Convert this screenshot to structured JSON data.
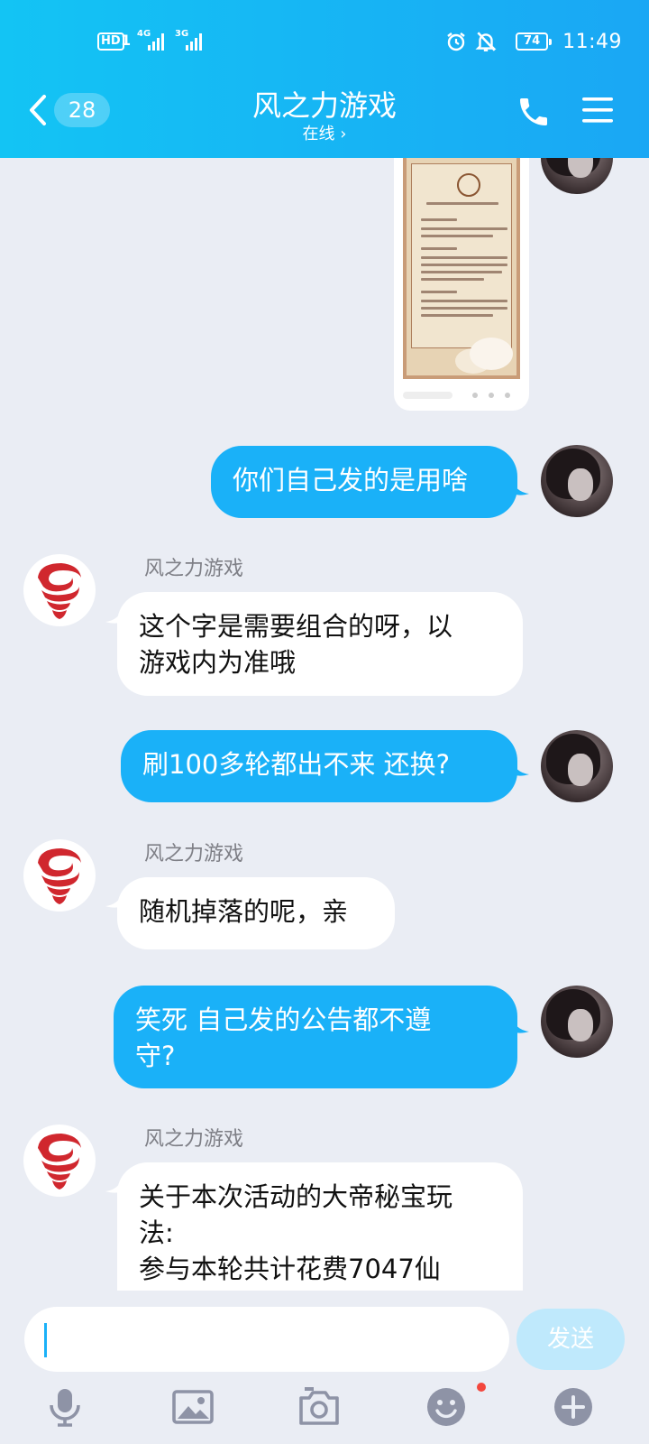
{
  "status_bar": {
    "hd": "HD",
    "sim1": "1",
    "net1": "4G",
    "net2": "3G",
    "battery": "74",
    "time": "11:49"
  },
  "header": {
    "back_count": "28",
    "title": "风之力游戏",
    "subtitle": "在线 ›"
  },
  "messages": [
    {
      "side": "me",
      "type": "image",
      "icon": "announcement-poster-image"
    },
    {
      "side": "me",
      "text": "你们自己发的是用啥"
    },
    {
      "side": "them",
      "sender": "风之力游戏",
      "lines": [
        "这个字是需要组合的呀，以",
        "游戏内为准哦"
      ]
    },
    {
      "side": "me",
      "text": "刷100多轮都出不来 还换?"
    },
    {
      "side": "them",
      "sender": "风之力游戏",
      "text": "随机掉落的呢，亲"
    },
    {
      "side": "me",
      "lines": [
        "笑死 自己发的公告都不遵",
        "守?"
      ]
    },
    {
      "side": "them",
      "sender": "风之力游戏",
      "lines": [
        "关于本次活动的大帝秘宝玩",
        "法:",
        "参与本轮共计花费7047仙"
      ]
    }
  ],
  "input": {
    "value": "",
    "send_label": "发送"
  },
  "toolbar": [
    "microphone-icon",
    "image-icon",
    "camera-icon",
    "emoji-icon",
    "plus-icon"
  ],
  "colors": {
    "header_start": "#13c4f4",
    "header_end": "#1aa7f4",
    "my_bubble": "#1ab1f8",
    "their_bubble": "#ffffff",
    "background": "#eaedf4",
    "send_disabled": "#bfe9fc",
    "badge_dot": "#f3473d"
  }
}
